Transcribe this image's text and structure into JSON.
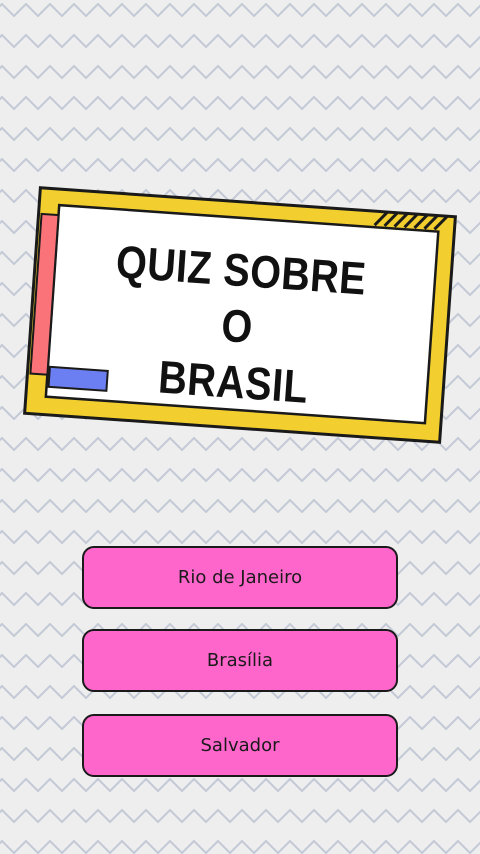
{
  "title": {
    "line1": "QUIZ SOBRE O",
    "line2": "BRASIL"
  },
  "answers": [
    {
      "label": "Rio de Janeiro"
    },
    {
      "label": "Brasília"
    },
    {
      "label": "Salvador"
    }
  ],
  "colors": {
    "background": "#eeeeee",
    "zigzag": "#c3c9d6",
    "card_frame": "#f2cf2e",
    "card_fill": "#ffffff",
    "accent_red": "#fa7378",
    "accent_blue": "#6b7ff2",
    "button_fill": "#ff66cc",
    "outline": "#1a1a1a"
  }
}
